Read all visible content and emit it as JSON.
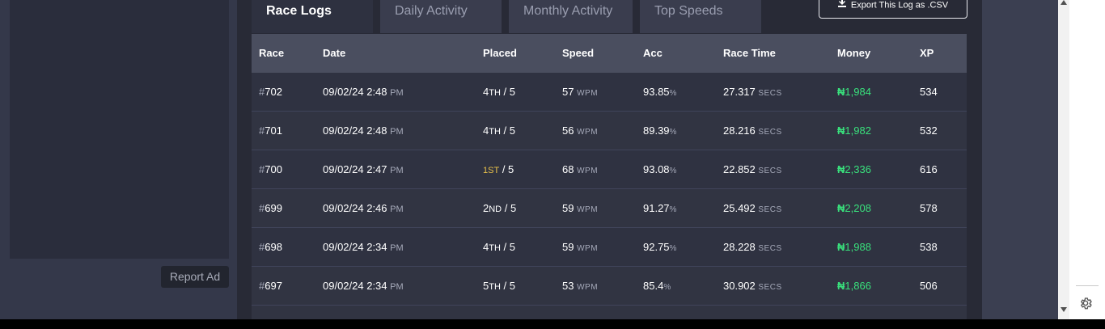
{
  "left": {
    "report_ad_label": "Report Ad"
  },
  "tabs": [
    {
      "label": "Race Logs",
      "active": true
    },
    {
      "label": "Daily Activity",
      "active": false
    },
    {
      "label": "Monthly Activity",
      "active": false
    },
    {
      "label": "Top Speeds",
      "active": false
    }
  ],
  "export_button": {
    "label": "Export This Log as .CSV",
    "icon": "download-icon"
  },
  "table": {
    "headers": [
      "Race",
      "Date",
      "Placed",
      "Speed",
      "Acc",
      "Race Time",
      "Money",
      "XP"
    ],
    "rows": [
      {
        "hash": "#",
        "race": "702",
        "date": "09/02/24 2:48",
        "ampm": "PM",
        "place_num": "4",
        "place_suffix": "TH",
        "place_total": "/ 5",
        "speed": "57",
        "speed_unit": "WPM",
        "acc": "93.85",
        "acc_unit": "%",
        "time": "27.317",
        "time_unit": "SECS",
        "money_symbol": "₦",
        "money": "1,984",
        "xp": "534"
      },
      {
        "hash": "#",
        "race": "701",
        "date": "09/02/24 2:48",
        "ampm": "PM",
        "place_num": "4",
        "place_suffix": "TH",
        "place_total": "/ 5",
        "speed": "56",
        "speed_unit": "WPM",
        "acc": "89.39",
        "acc_unit": "%",
        "time": "28.216",
        "time_unit": "SECS",
        "money_symbol": "₦",
        "money": "1,982",
        "xp": "532"
      },
      {
        "hash": "#",
        "race": "700",
        "date": "09/02/24 2:47",
        "ampm": "PM",
        "place_num": "1",
        "place_suffix": "ST",
        "place_total": "/ 5",
        "speed": "68",
        "speed_unit": "WPM",
        "acc": "93.08",
        "acc_unit": "%",
        "time": "22.852",
        "time_unit": "SECS",
        "money_symbol": "₦",
        "money": "2,336",
        "xp": "616"
      },
      {
        "hash": "#",
        "race": "699",
        "date": "09/02/24 2:46",
        "ampm": "PM",
        "place_num": "2",
        "place_suffix": "ND",
        "place_total": "/ 5",
        "speed": "59",
        "speed_unit": "WPM",
        "acc": "91.27",
        "acc_unit": "%",
        "time": "25.492",
        "time_unit": "SECS",
        "money_symbol": "₦",
        "money": "2,208",
        "xp": "578"
      },
      {
        "hash": "#",
        "race": "698",
        "date": "09/02/24 2:34",
        "ampm": "PM",
        "place_num": "4",
        "place_suffix": "TH",
        "place_total": "/ 5",
        "speed": "59",
        "speed_unit": "WPM",
        "acc": "92.75",
        "acc_unit": "%",
        "time": "28.228",
        "time_unit": "SECS",
        "money_symbol": "₦",
        "money": "1,988",
        "xp": "538"
      },
      {
        "hash": "#",
        "race": "697",
        "date": "09/02/24 2:34",
        "ampm": "PM",
        "place_num": "5",
        "place_suffix": "TH",
        "place_total": "/ 5",
        "speed": "53",
        "speed_unit": "WPM",
        "acc": "85.4",
        "acc_unit": "%",
        "time": "30.902",
        "time_unit": "SECS",
        "money_symbol": "₦",
        "money": "1,866",
        "xp": "506"
      }
    ]
  },
  "colors": {
    "money": "#39e07c",
    "first_place": "#e8c14b",
    "header_bg": "#4a4e5f",
    "page_bg": "#282a36"
  },
  "browser": {
    "settings_icon": "gear-icon"
  }
}
